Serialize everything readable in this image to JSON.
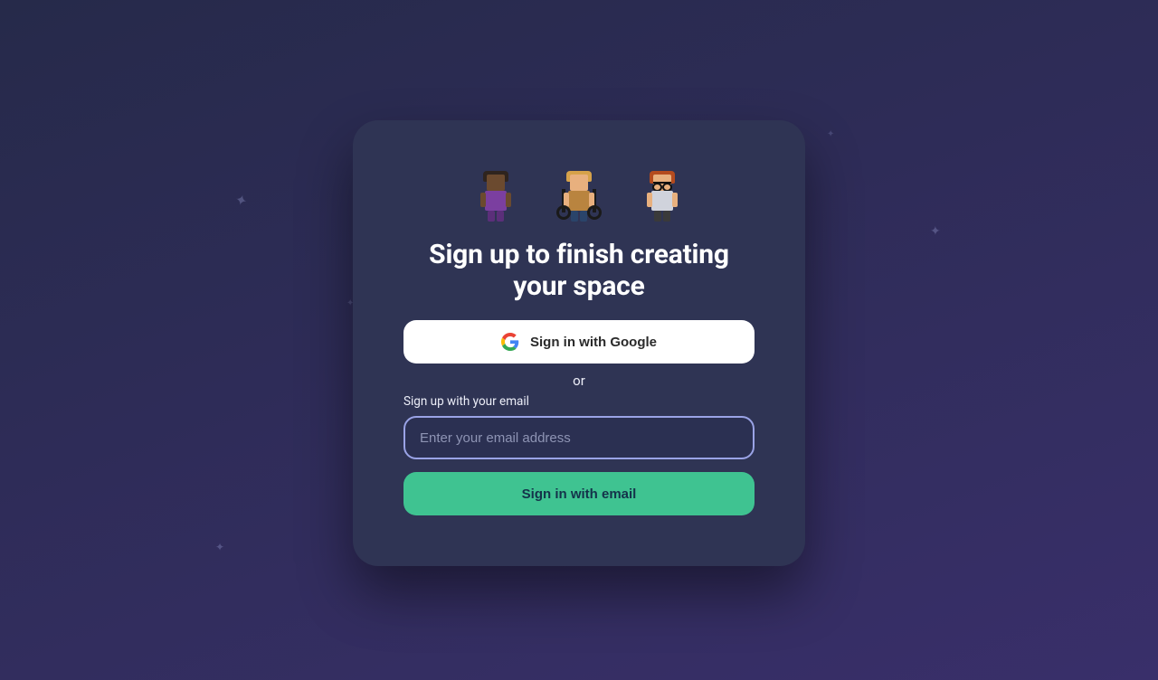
{
  "signup": {
    "title": "Sign up to finish creating your space",
    "google_button_label": "Sign in with Google",
    "or_text": "or",
    "email_label": "Sign up with your email",
    "email_placeholder": "Enter your email address",
    "email_value": "",
    "email_button_label": "Sign in with email"
  }
}
